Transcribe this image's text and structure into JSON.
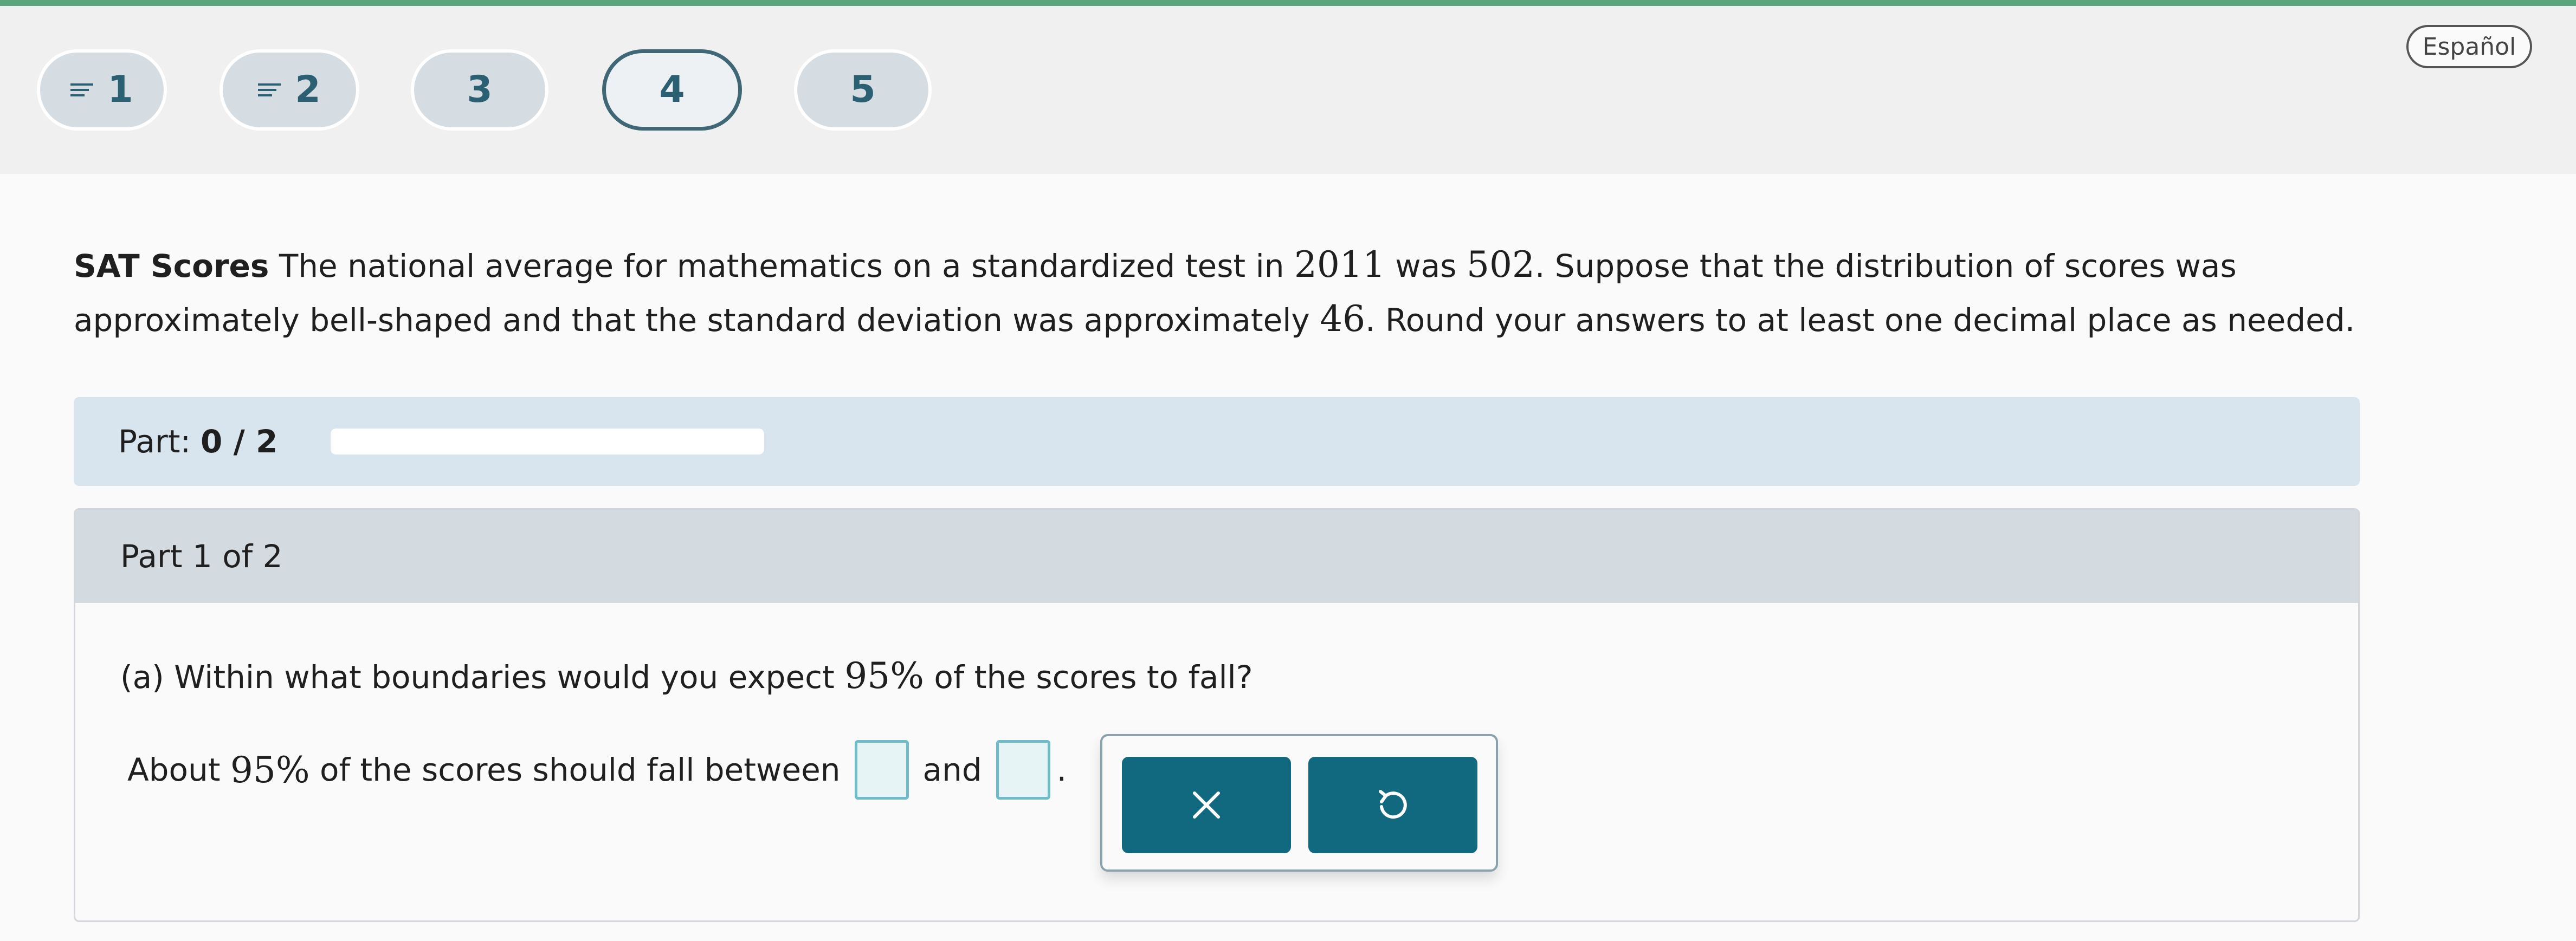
{
  "nav": {
    "questions": [
      {
        "number": "1",
        "has_lines": true,
        "active": false
      },
      {
        "number": "2",
        "has_lines": true,
        "active": false
      },
      {
        "number": "3",
        "has_lines": false,
        "active": false
      },
      {
        "number": "4",
        "has_lines": false,
        "active": true
      },
      {
        "number": "5",
        "has_lines": false,
        "active": false
      }
    ],
    "language_button": "Español"
  },
  "problem": {
    "title": "SAT Scores",
    "text_1": " The national average for mathematics on a standardized test in ",
    "year": "2011",
    "text_2": " was ",
    "mean": "502",
    "text_3": ". Suppose that the distribution of scores was approximately bell-shaped and that the standard deviation was approximately ",
    "sd": "46",
    "text_4": ". Round your answers to at least one decimal place as needed."
  },
  "progress": {
    "label": "Part:",
    "value_text": "0 / 2",
    "completed_fraction": 0
  },
  "part": {
    "header": "Part 1 of 2",
    "question_prefix": "(a) Within what boundaries would you expect ",
    "question_percent": "95%",
    "question_suffix": " of the scores to fall?",
    "answer_prefix": "About ",
    "answer_percent": "95%",
    "answer_mid": " of the scores should fall between",
    "answer_and": "and",
    "answer_end": "."
  },
  "tools": {
    "clear_icon": "close-icon",
    "undo_icon": "undo-icon"
  },
  "colors": {
    "accent_green": "#5aa57c",
    "pill_bg": "#d5dde3",
    "pill_text": "#2b5f72",
    "tool_button": "#11697f",
    "answer_box_border": "#6fbcc9"
  }
}
